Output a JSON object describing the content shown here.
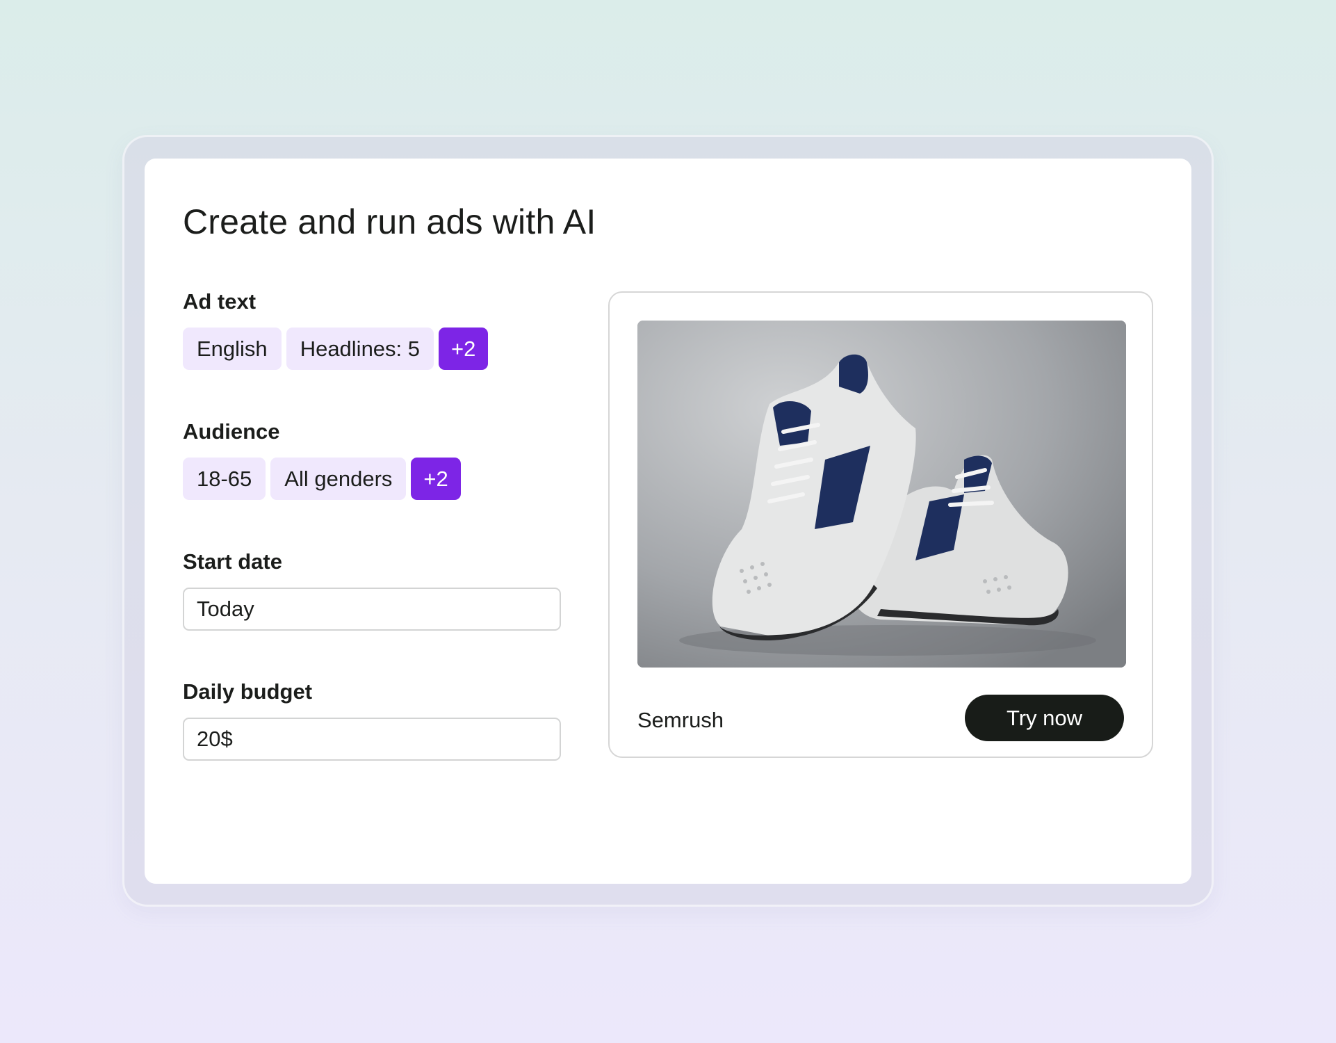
{
  "page": {
    "title": "Create and run ads with AI"
  },
  "ad_text": {
    "label": "Ad text",
    "chips": [
      "English",
      "Headlines: 5"
    ],
    "more": "+2"
  },
  "audience": {
    "label": "Audience",
    "chips": [
      "18-65",
      "All genders"
    ],
    "more": "+2"
  },
  "start_date": {
    "label": "Start date",
    "value": "Today"
  },
  "daily_budget": {
    "label": "Daily budget",
    "value": "20$"
  },
  "preview": {
    "image": "sneakers-photo",
    "brand": "Semrush",
    "cta_label": "Try now"
  },
  "colors": {
    "accent": "#7d25e6",
    "chip_bg": "#f0e8fd",
    "cta_bg": "#181c18"
  }
}
